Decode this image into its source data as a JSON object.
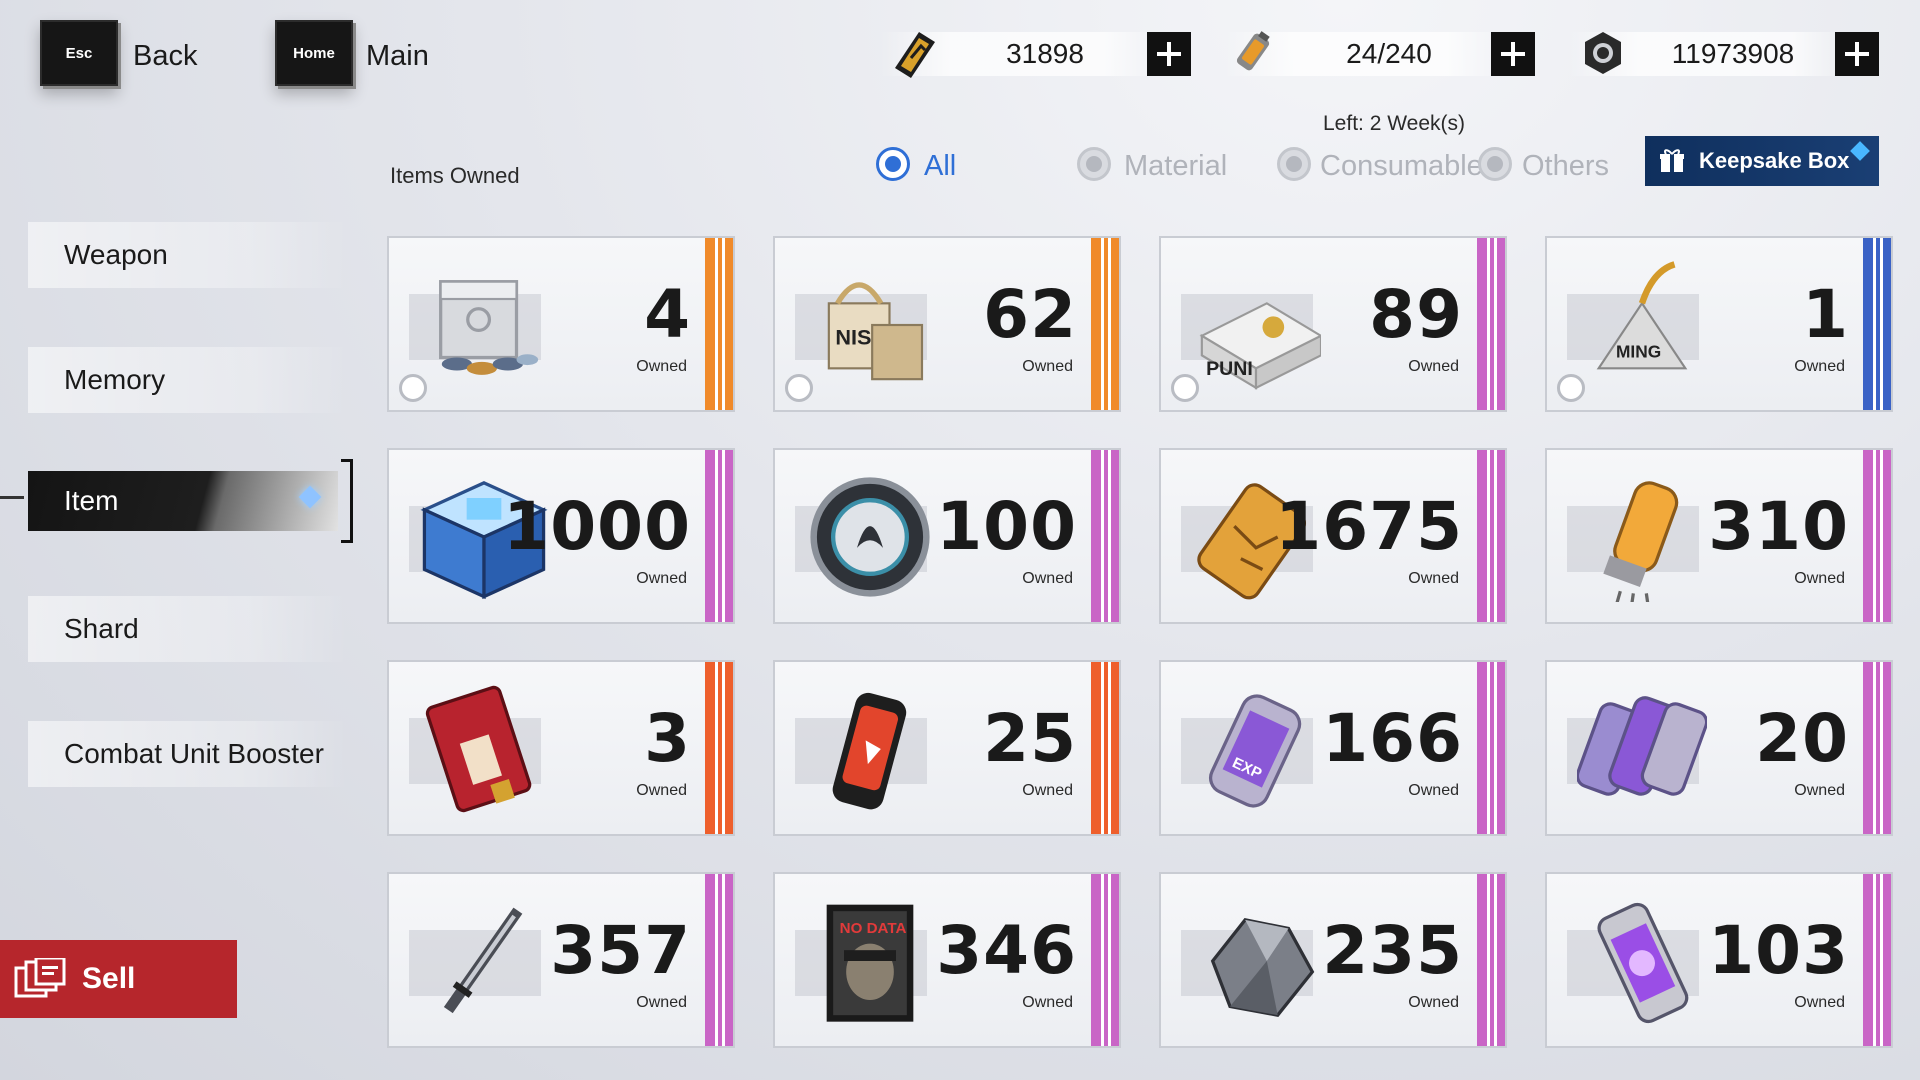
{
  "nav": {
    "back_key": "Esc",
    "back_label": "Back",
    "home_key": "Home",
    "main_label": "Main"
  },
  "currencies": [
    {
      "icon": "ticket-icon",
      "value": "31898"
    },
    {
      "icon": "battery-icon",
      "value": "24/240"
    },
    {
      "icon": "gear-nut-icon",
      "value": "11973908"
    }
  ],
  "timer": "Left: 2 Week(s)",
  "items_owned_label": "Items Owned",
  "filters": [
    {
      "label": "All",
      "active": true
    },
    {
      "label": "Material",
      "active": false
    },
    {
      "label": "Consumable",
      "active": false
    },
    {
      "label": "Others",
      "active": false
    }
  ],
  "keepsake_label": "Keepsake Box",
  "sidebar": [
    {
      "label": "Weapon",
      "active": false
    },
    {
      "label": "Memory",
      "active": false
    },
    {
      "label": "Item",
      "active": true
    },
    {
      "label": "Shard",
      "active": false
    },
    {
      "label": "Combat Unit Booster",
      "active": false
    }
  ],
  "sell_label": "Sell",
  "owned_label": "Owned",
  "colors": {
    "orange": "#f08a2a",
    "purple": "#c965c6",
    "blue": "#3a62c6",
    "red_orange": "#ee5f2c",
    "accent_blue": "#2f6fd6",
    "sell_red": "#b6262c"
  },
  "items": [
    {
      "count": "4",
      "icon": "supply-crate-icon",
      "rarity": "orange",
      "selectable": true
    },
    {
      "count": "62",
      "icon": "gift-bags-icon",
      "rarity": "orange",
      "selectable": true
    },
    {
      "count": "89",
      "icon": "wrapped-gift-icon",
      "rarity": "purple",
      "selectable": true
    },
    {
      "count": "1",
      "icon": "ribbon-tag-icon",
      "rarity": "blue",
      "selectable": true
    },
    {
      "count": "1000",
      "icon": "data-cube-icon",
      "rarity": "purple",
      "selectable": false
    },
    {
      "count": "100",
      "icon": "emblem-disc-icon",
      "rarity": "purple",
      "selectable": false
    },
    {
      "count": "1675",
      "icon": "chip-card-icon",
      "rarity": "purple",
      "selectable": false
    },
    {
      "count": "310",
      "icon": "vacuum-tube-icon",
      "rarity": "purple",
      "selectable": false
    },
    {
      "count": "3",
      "icon": "red-card-icon",
      "rarity": "red_orange",
      "selectable": false
    },
    {
      "count": "25",
      "icon": "red-canister-icon",
      "rarity": "red_orange",
      "selectable": false
    },
    {
      "count": "166",
      "icon": "exp-canister-icon",
      "rarity": "purple",
      "selectable": false
    },
    {
      "count": "20",
      "icon": "exp-canister-pack-icon",
      "rarity": "purple",
      "selectable": false
    },
    {
      "count": "357",
      "icon": "blade-icon",
      "rarity": "purple",
      "selectable": false
    },
    {
      "count": "346",
      "icon": "no-data-portrait-icon",
      "rarity": "purple",
      "selectable": false
    },
    {
      "count": "235",
      "icon": "ore-chunk-icon",
      "rarity": "purple",
      "selectable": false
    },
    {
      "count": "103",
      "icon": "purple-capsule-icon",
      "rarity": "purple",
      "selectable": false
    }
  ]
}
